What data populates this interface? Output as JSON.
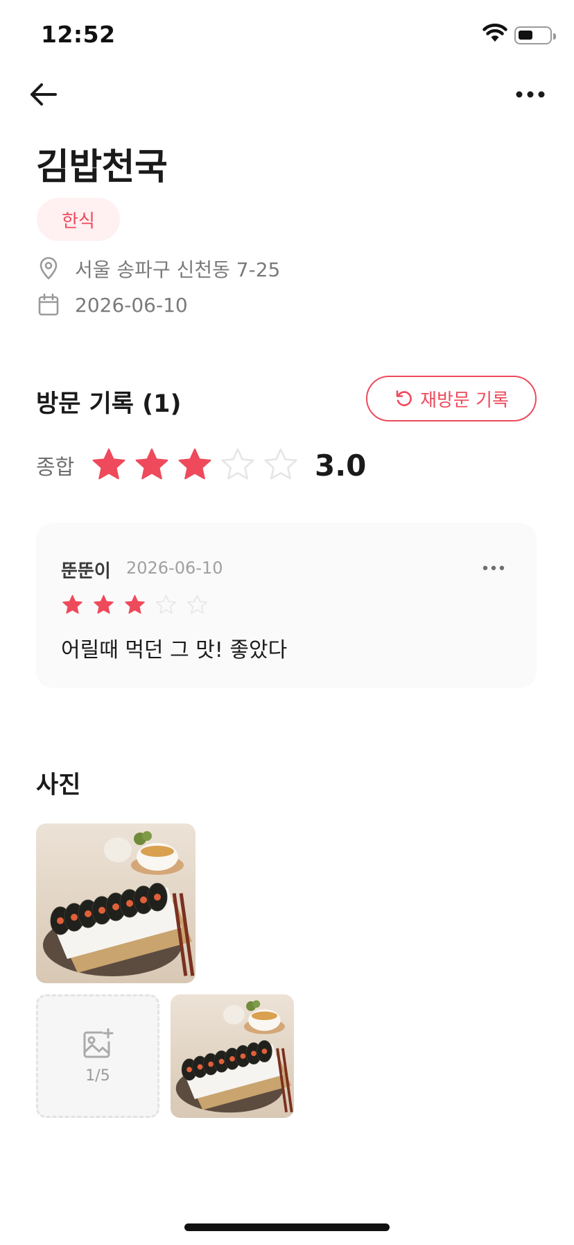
{
  "status_bar": {
    "time": "12:52"
  },
  "restaurant": {
    "name": "김밥천국",
    "category": "한식",
    "address": "서울 송파구 신천동 7-25",
    "date": "2026-06-10"
  },
  "visits": {
    "title": "방문 기록 (1)",
    "revisit_label": "재방문 기록",
    "overall_label": "종합",
    "overall_rating": 3,
    "overall_score": "3.0",
    "max_rating": 5
  },
  "review": {
    "author": "뚠뚠이",
    "date": "2026-06-10",
    "rating": 3,
    "text": "어릴때 먹던 그 맛! 좋았다"
  },
  "photos": {
    "title": "사진",
    "upload_count": "1/5"
  },
  "colors": {
    "accent": "#ee4a5c",
    "badge_bg": "#fff0f1",
    "card_bg": "#fafafa",
    "star_empty": "#e6e6e6"
  },
  "icons": [
    "back-arrow-icon",
    "more-horizontal-icon",
    "location-pin-icon",
    "calendar-icon",
    "refresh-icon",
    "star-icon",
    "add-image-icon",
    "wifi-icon",
    "battery-icon"
  ]
}
